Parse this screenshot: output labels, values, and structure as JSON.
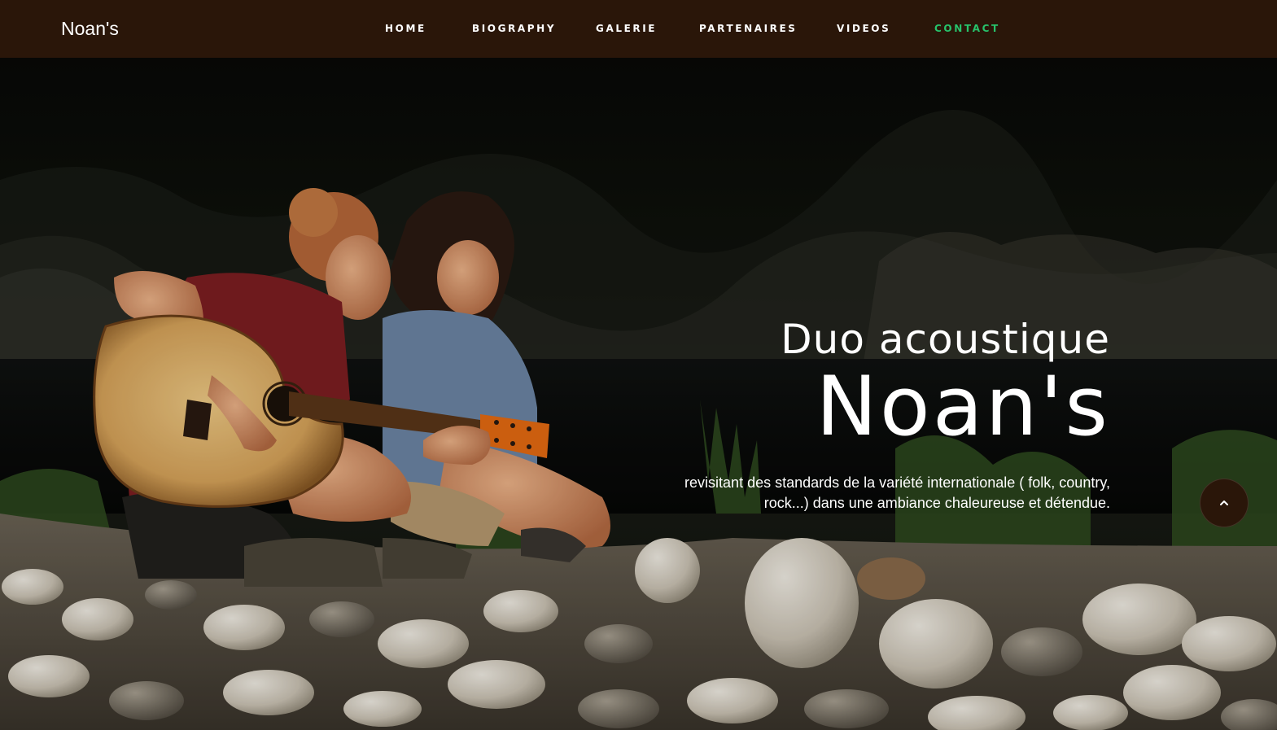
{
  "site": {
    "brand": "Noan's"
  },
  "nav": {
    "items": [
      {
        "label": "HOME",
        "active": false
      },
      {
        "label": "BIOGRAPHY",
        "active": false
      },
      {
        "label": "GALERIE",
        "active": false
      },
      {
        "label": "PARTENAIRES",
        "active": false
      },
      {
        "label": "VIDEOS",
        "active": false
      },
      {
        "label": "CONTACT",
        "active": true
      }
    ]
  },
  "hero": {
    "kicker": "Duo acoustique",
    "title": "Noan's",
    "description": "revisitant des standards de la variété internationale ( folk, country, rock...) dans une ambiance chaleureuse et détendue."
  },
  "scroll_top": {
    "icon": "chevron-up-icon"
  },
  "colors": {
    "navbar_bg": "#2a1609",
    "nav_active": "#27c36b",
    "text": "#ffffff"
  }
}
